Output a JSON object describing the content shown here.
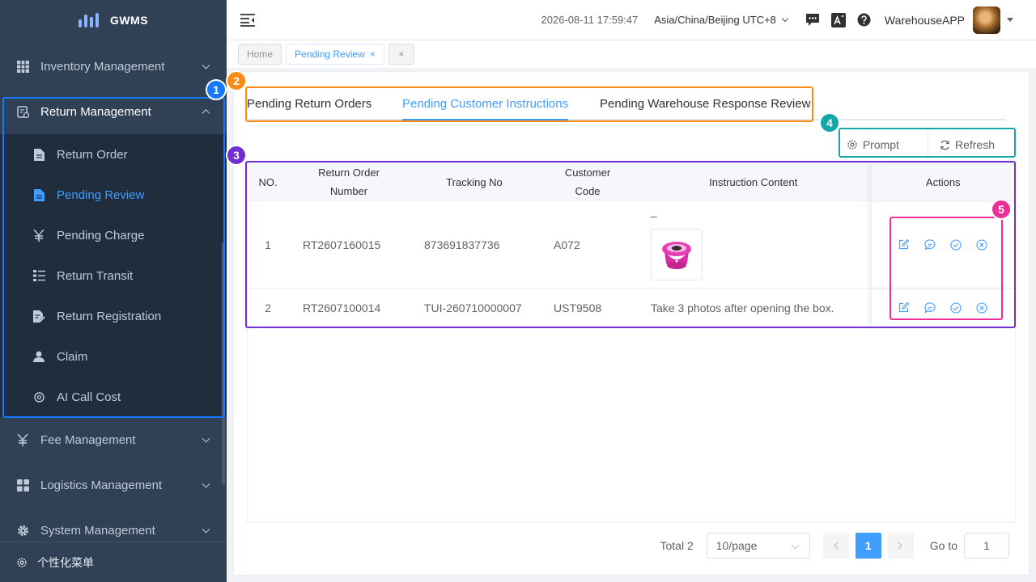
{
  "app": {
    "name": "GWMS"
  },
  "sidebar": {
    "menus": [
      {
        "label": "Inventory Management",
        "icon": "grid-icon"
      },
      {
        "label": "Return Management",
        "icon": "return-icon"
      }
    ],
    "return_submenu": [
      {
        "label": "Return Order",
        "icon": "document-icon"
      },
      {
        "label": "Pending Review",
        "icon": "document-icon"
      },
      {
        "label": "Pending Charge",
        "icon": "yen-icon"
      },
      {
        "label": "Return Transit",
        "icon": "list-icon"
      },
      {
        "label": "Return Registration",
        "icon": "edit-doc-icon"
      },
      {
        "label": "Claim",
        "icon": "user-icon"
      },
      {
        "label": "AI Call Cost",
        "icon": "coin-icon"
      }
    ],
    "menus_after": [
      {
        "label": "Fee Management",
        "icon": "yen-icon"
      },
      {
        "label": "Logistics Management",
        "icon": "apps-icon"
      },
      {
        "label": "System Management",
        "icon": "gear-icon"
      }
    ],
    "footer": "个性化菜单"
  },
  "header": {
    "datetime": "2026-08-11 17:59:47",
    "timezone": "Asia/China/Beijing UTC+8",
    "user": "WarehouseAPP"
  },
  "tags": {
    "home": "Home",
    "current": "Pending Review",
    "close_symbol": "×"
  },
  "tabs": [
    {
      "label": "Pending Return Orders"
    },
    {
      "label": "Pending Customer Instructions"
    },
    {
      "label": "Pending Warehouse Response Review"
    }
  ],
  "toolbar": {
    "prompt": "Prompt",
    "refresh": "Refresh"
  },
  "table": {
    "headers": {
      "no": "NO.",
      "return_order_line1": "Return Order",
      "return_order_line2": "Number",
      "tracking": "Tracking No",
      "customer_line1": "Customer",
      "customer_line2": "Code",
      "instruction": "Instruction Content",
      "actions": "Actions"
    },
    "rows": [
      {
        "no": "1",
        "return_order": "RT2607160015",
        "tracking": "873691837736",
        "customer": "A072",
        "instruction": "–"
      },
      {
        "no": "2",
        "return_order": "RT2607100014",
        "tracking": "TUI-260710000007",
        "customer": "UST9508",
        "instruction": "Take 3 photos after opening the box."
      }
    ]
  },
  "pagination": {
    "total": "Total 2",
    "page_size": "10/page",
    "current_page": "1",
    "goto_label": "Go to",
    "goto_value": "1"
  },
  "annotations": [
    {
      "label": "1",
      "color": "#1677ff"
    },
    {
      "label": "2",
      "color": "#fa8c16"
    },
    {
      "label": "3",
      "color": "#722ed1"
    },
    {
      "label": "4",
      "color": "#13a8a8"
    },
    {
      "label": "5",
      "color": "#eb2f96"
    }
  ],
  "colors": {
    "primary": "#409eff",
    "sidebar_bg": "#304156",
    "submenu_bg": "#1f2d3d"
  }
}
